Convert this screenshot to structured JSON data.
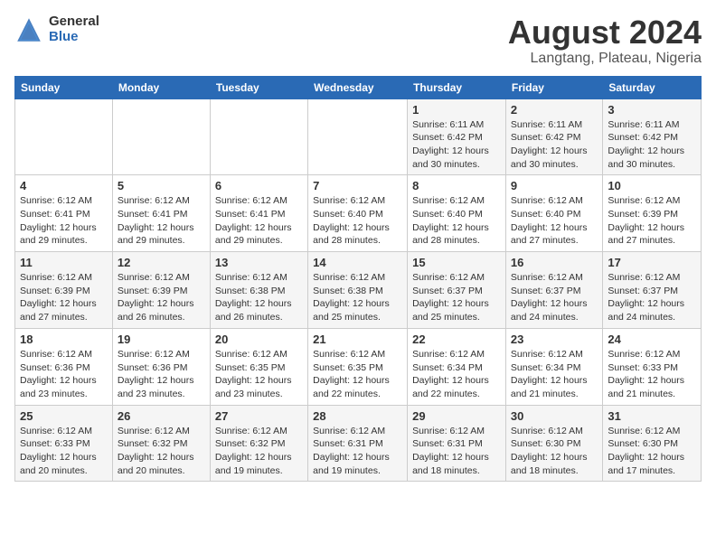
{
  "header": {
    "logo_general": "General",
    "logo_blue": "Blue",
    "title": "August 2024",
    "subtitle": "Langtang, Plateau, Nigeria"
  },
  "calendar": {
    "days_of_week": [
      "Sunday",
      "Monday",
      "Tuesday",
      "Wednesday",
      "Thursday",
      "Friday",
      "Saturday"
    ],
    "weeks": [
      [
        {
          "day": "",
          "info": ""
        },
        {
          "day": "",
          "info": ""
        },
        {
          "day": "",
          "info": ""
        },
        {
          "day": "",
          "info": ""
        },
        {
          "day": "1",
          "info": "Sunrise: 6:11 AM\nSunset: 6:42 PM\nDaylight: 12 hours\nand 30 minutes."
        },
        {
          "day": "2",
          "info": "Sunrise: 6:11 AM\nSunset: 6:42 PM\nDaylight: 12 hours\nand 30 minutes."
        },
        {
          "day": "3",
          "info": "Sunrise: 6:11 AM\nSunset: 6:42 PM\nDaylight: 12 hours\nand 30 minutes."
        }
      ],
      [
        {
          "day": "4",
          "info": "Sunrise: 6:12 AM\nSunset: 6:41 PM\nDaylight: 12 hours\nand 29 minutes."
        },
        {
          "day": "5",
          "info": "Sunrise: 6:12 AM\nSunset: 6:41 PM\nDaylight: 12 hours\nand 29 minutes."
        },
        {
          "day": "6",
          "info": "Sunrise: 6:12 AM\nSunset: 6:41 PM\nDaylight: 12 hours\nand 29 minutes."
        },
        {
          "day": "7",
          "info": "Sunrise: 6:12 AM\nSunset: 6:40 PM\nDaylight: 12 hours\nand 28 minutes."
        },
        {
          "day": "8",
          "info": "Sunrise: 6:12 AM\nSunset: 6:40 PM\nDaylight: 12 hours\nand 28 minutes."
        },
        {
          "day": "9",
          "info": "Sunrise: 6:12 AM\nSunset: 6:40 PM\nDaylight: 12 hours\nand 27 minutes."
        },
        {
          "day": "10",
          "info": "Sunrise: 6:12 AM\nSunset: 6:39 PM\nDaylight: 12 hours\nand 27 minutes."
        }
      ],
      [
        {
          "day": "11",
          "info": "Sunrise: 6:12 AM\nSunset: 6:39 PM\nDaylight: 12 hours\nand 27 minutes."
        },
        {
          "day": "12",
          "info": "Sunrise: 6:12 AM\nSunset: 6:39 PM\nDaylight: 12 hours\nand 26 minutes."
        },
        {
          "day": "13",
          "info": "Sunrise: 6:12 AM\nSunset: 6:38 PM\nDaylight: 12 hours\nand 26 minutes."
        },
        {
          "day": "14",
          "info": "Sunrise: 6:12 AM\nSunset: 6:38 PM\nDaylight: 12 hours\nand 25 minutes."
        },
        {
          "day": "15",
          "info": "Sunrise: 6:12 AM\nSunset: 6:37 PM\nDaylight: 12 hours\nand 25 minutes."
        },
        {
          "day": "16",
          "info": "Sunrise: 6:12 AM\nSunset: 6:37 PM\nDaylight: 12 hours\nand 24 minutes."
        },
        {
          "day": "17",
          "info": "Sunrise: 6:12 AM\nSunset: 6:37 PM\nDaylight: 12 hours\nand 24 minutes."
        }
      ],
      [
        {
          "day": "18",
          "info": "Sunrise: 6:12 AM\nSunset: 6:36 PM\nDaylight: 12 hours\nand 23 minutes."
        },
        {
          "day": "19",
          "info": "Sunrise: 6:12 AM\nSunset: 6:36 PM\nDaylight: 12 hours\nand 23 minutes."
        },
        {
          "day": "20",
          "info": "Sunrise: 6:12 AM\nSunset: 6:35 PM\nDaylight: 12 hours\nand 23 minutes."
        },
        {
          "day": "21",
          "info": "Sunrise: 6:12 AM\nSunset: 6:35 PM\nDaylight: 12 hours\nand 22 minutes."
        },
        {
          "day": "22",
          "info": "Sunrise: 6:12 AM\nSunset: 6:34 PM\nDaylight: 12 hours\nand 22 minutes."
        },
        {
          "day": "23",
          "info": "Sunrise: 6:12 AM\nSunset: 6:34 PM\nDaylight: 12 hours\nand 21 minutes."
        },
        {
          "day": "24",
          "info": "Sunrise: 6:12 AM\nSunset: 6:33 PM\nDaylight: 12 hours\nand 21 minutes."
        }
      ],
      [
        {
          "day": "25",
          "info": "Sunrise: 6:12 AM\nSunset: 6:33 PM\nDaylight: 12 hours\nand 20 minutes."
        },
        {
          "day": "26",
          "info": "Sunrise: 6:12 AM\nSunset: 6:32 PM\nDaylight: 12 hours\nand 20 minutes."
        },
        {
          "day": "27",
          "info": "Sunrise: 6:12 AM\nSunset: 6:32 PM\nDaylight: 12 hours\nand 19 minutes."
        },
        {
          "day": "28",
          "info": "Sunrise: 6:12 AM\nSunset: 6:31 PM\nDaylight: 12 hours\nand 19 minutes."
        },
        {
          "day": "29",
          "info": "Sunrise: 6:12 AM\nSunset: 6:31 PM\nDaylight: 12 hours\nand 18 minutes."
        },
        {
          "day": "30",
          "info": "Sunrise: 6:12 AM\nSunset: 6:30 PM\nDaylight: 12 hours\nand 18 minutes."
        },
        {
          "day": "31",
          "info": "Sunrise: 6:12 AM\nSunset: 6:30 PM\nDaylight: 12 hours\nand 17 minutes."
        }
      ]
    ]
  }
}
